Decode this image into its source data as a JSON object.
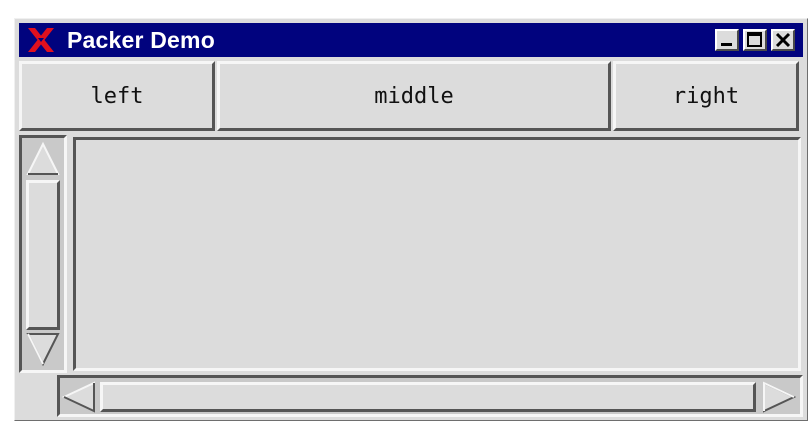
{
  "window": {
    "title": "Packer Demo",
    "title_bar_color": "#01037e",
    "controls": {
      "minimize_icon": "minimize-icon",
      "maximize_icon": "maximize-icon",
      "close_icon": "close-icon"
    },
    "app_icon": "x-logo-icon"
  },
  "buttons": {
    "left_label": "left",
    "middle_label": "middle",
    "right_label": "right"
  },
  "scrollbars": {
    "vertical": {
      "up_icon": "arrow-up-icon",
      "down_icon": "arrow-down-icon"
    },
    "horizontal": {
      "left_icon": "arrow-left-icon",
      "right_icon": "arrow-right-icon"
    }
  },
  "colors": {
    "background": "#dcdcdc",
    "title_text": "#ffffff",
    "x_logo": "#e0101e"
  }
}
